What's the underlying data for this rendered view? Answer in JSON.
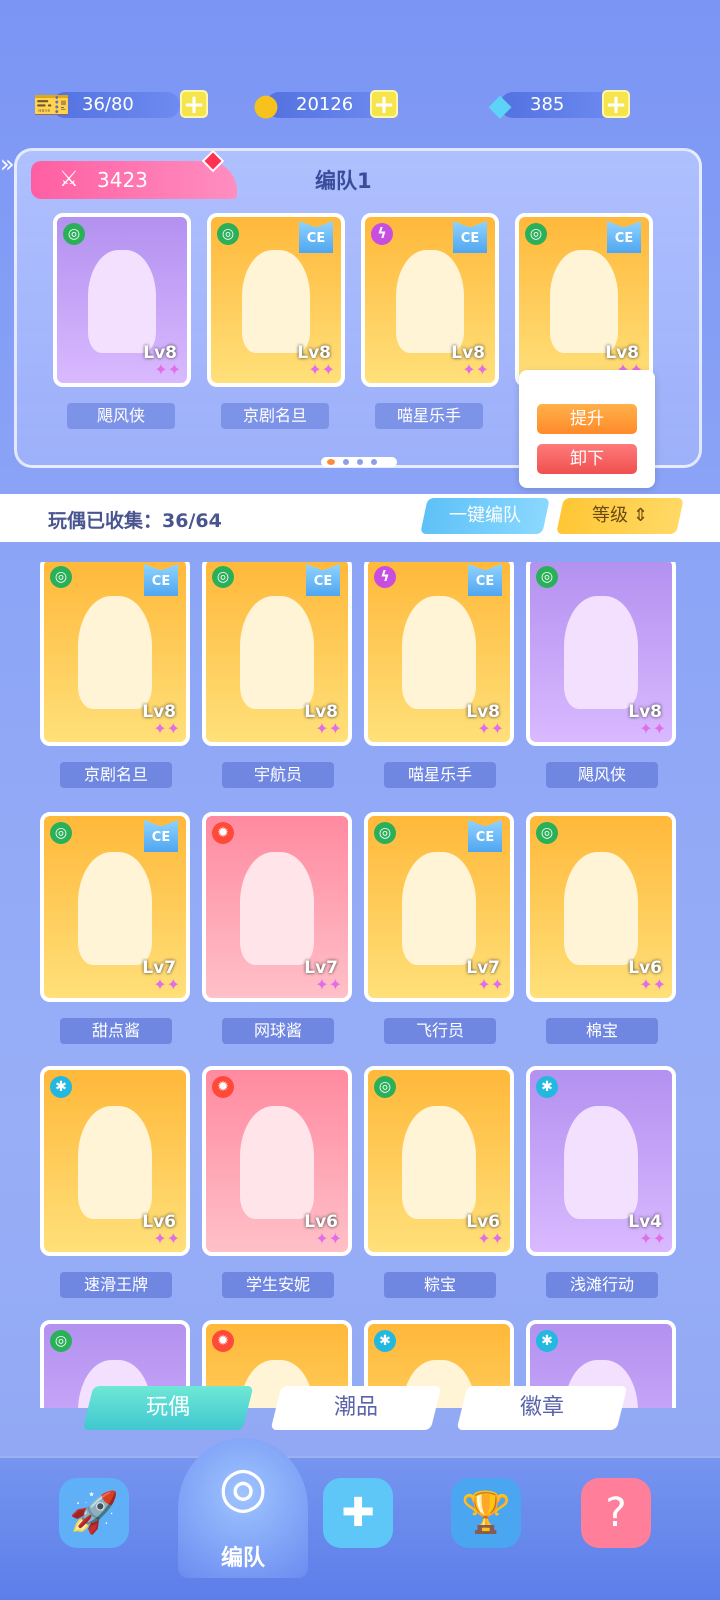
{
  "resources": {
    "tickets": {
      "value": "36/80",
      "icon": "ticket-icon"
    },
    "coins": {
      "value": "20126",
      "icon": "coin-icon"
    },
    "gems": {
      "value": "385",
      "icon": "crystal-icon"
    }
  },
  "team": {
    "power": "3423",
    "title": "编队1",
    "members": [
      {
        "name": "飓风侠",
        "level": "Lv8",
        "element": "spiral",
        "ce": false,
        "bg": "purple"
      },
      {
        "name": "京剧名旦",
        "level": "Lv8",
        "element": "spiral",
        "ce": true,
        "bg": "gold"
      },
      {
        "name": "喵星乐手",
        "level": "Lv8",
        "element": "bolt",
        "ce": true,
        "bg": "gold"
      },
      {
        "name": "",
        "level": "Lv8",
        "element": "spiral",
        "ce": true,
        "bg": "gold"
      }
    ],
    "popup": {
      "upgrade": "提升",
      "remove": "卸下"
    }
  },
  "collection": {
    "label": "玩偶已收集：",
    "count": "36/64",
    "one_click_team": "一键编队",
    "sort_label": "等级"
  },
  "cards": [
    {
      "name": "京剧名旦",
      "level": "Lv8",
      "element": "spiral",
      "ce": true,
      "bg": "gold"
    },
    {
      "name": "宇航员",
      "level": "Lv8",
      "element": "spiral",
      "ce": true,
      "bg": "gold"
    },
    {
      "name": "喵星乐手",
      "level": "Lv8",
      "element": "bolt",
      "ce": true,
      "bg": "gold"
    },
    {
      "name": "飓风侠",
      "level": "Lv8",
      "element": "spiral",
      "ce": false,
      "bg": "purple"
    },
    {
      "name": "甜点酱",
      "level": "Lv7",
      "element": "spiral",
      "ce": true,
      "bg": "gold"
    },
    {
      "name": "网球酱",
      "level": "Lv7",
      "element": "fire",
      "ce": false,
      "bg": "red"
    },
    {
      "name": "飞行员",
      "level": "Lv7",
      "element": "spiral",
      "ce": true,
      "bg": "gold"
    },
    {
      "name": "棉宝",
      "level": "Lv6",
      "element": "spiral",
      "ce": false,
      "bg": "gold"
    },
    {
      "name": "速滑王牌",
      "level": "Lv6",
      "element": "snow",
      "ce": false,
      "bg": "gold"
    },
    {
      "name": "学生安妮",
      "level": "Lv6",
      "element": "fire",
      "ce": false,
      "bg": "red"
    },
    {
      "name": "粽宝",
      "level": "Lv6",
      "element": "spiral",
      "ce": false,
      "bg": "gold"
    },
    {
      "name": "浅滩行动",
      "level": "Lv4",
      "element": "snow",
      "ce": false,
      "bg": "purple"
    },
    {
      "name": "",
      "level": "",
      "element": "spiral",
      "ce": false,
      "bg": "purple"
    },
    {
      "name": "",
      "level": "",
      "element": "fire",
      "ce": false,
      "bg": "gold"
    },
    {
      "name": "",
      "level": "",
      "element": "snow",
      "ce": false,
      "bg": "gold"
    },
    {
      "name": "",
      "level": "",
      "element": "snow",
      "ce": false,
      "bg": "purple"
    }
  ],
  "tabs": [
    "玩偶",
    "潮品",
    "徽章"
  ],
  "nav": {
    "center_label": "编队",
    "items": [
      "rocket-icon",
      "whistle-icon",
      "puzzle-icon",
      "trophy-icon",
      "mystery-machine-icon"
    ]
  }
}
